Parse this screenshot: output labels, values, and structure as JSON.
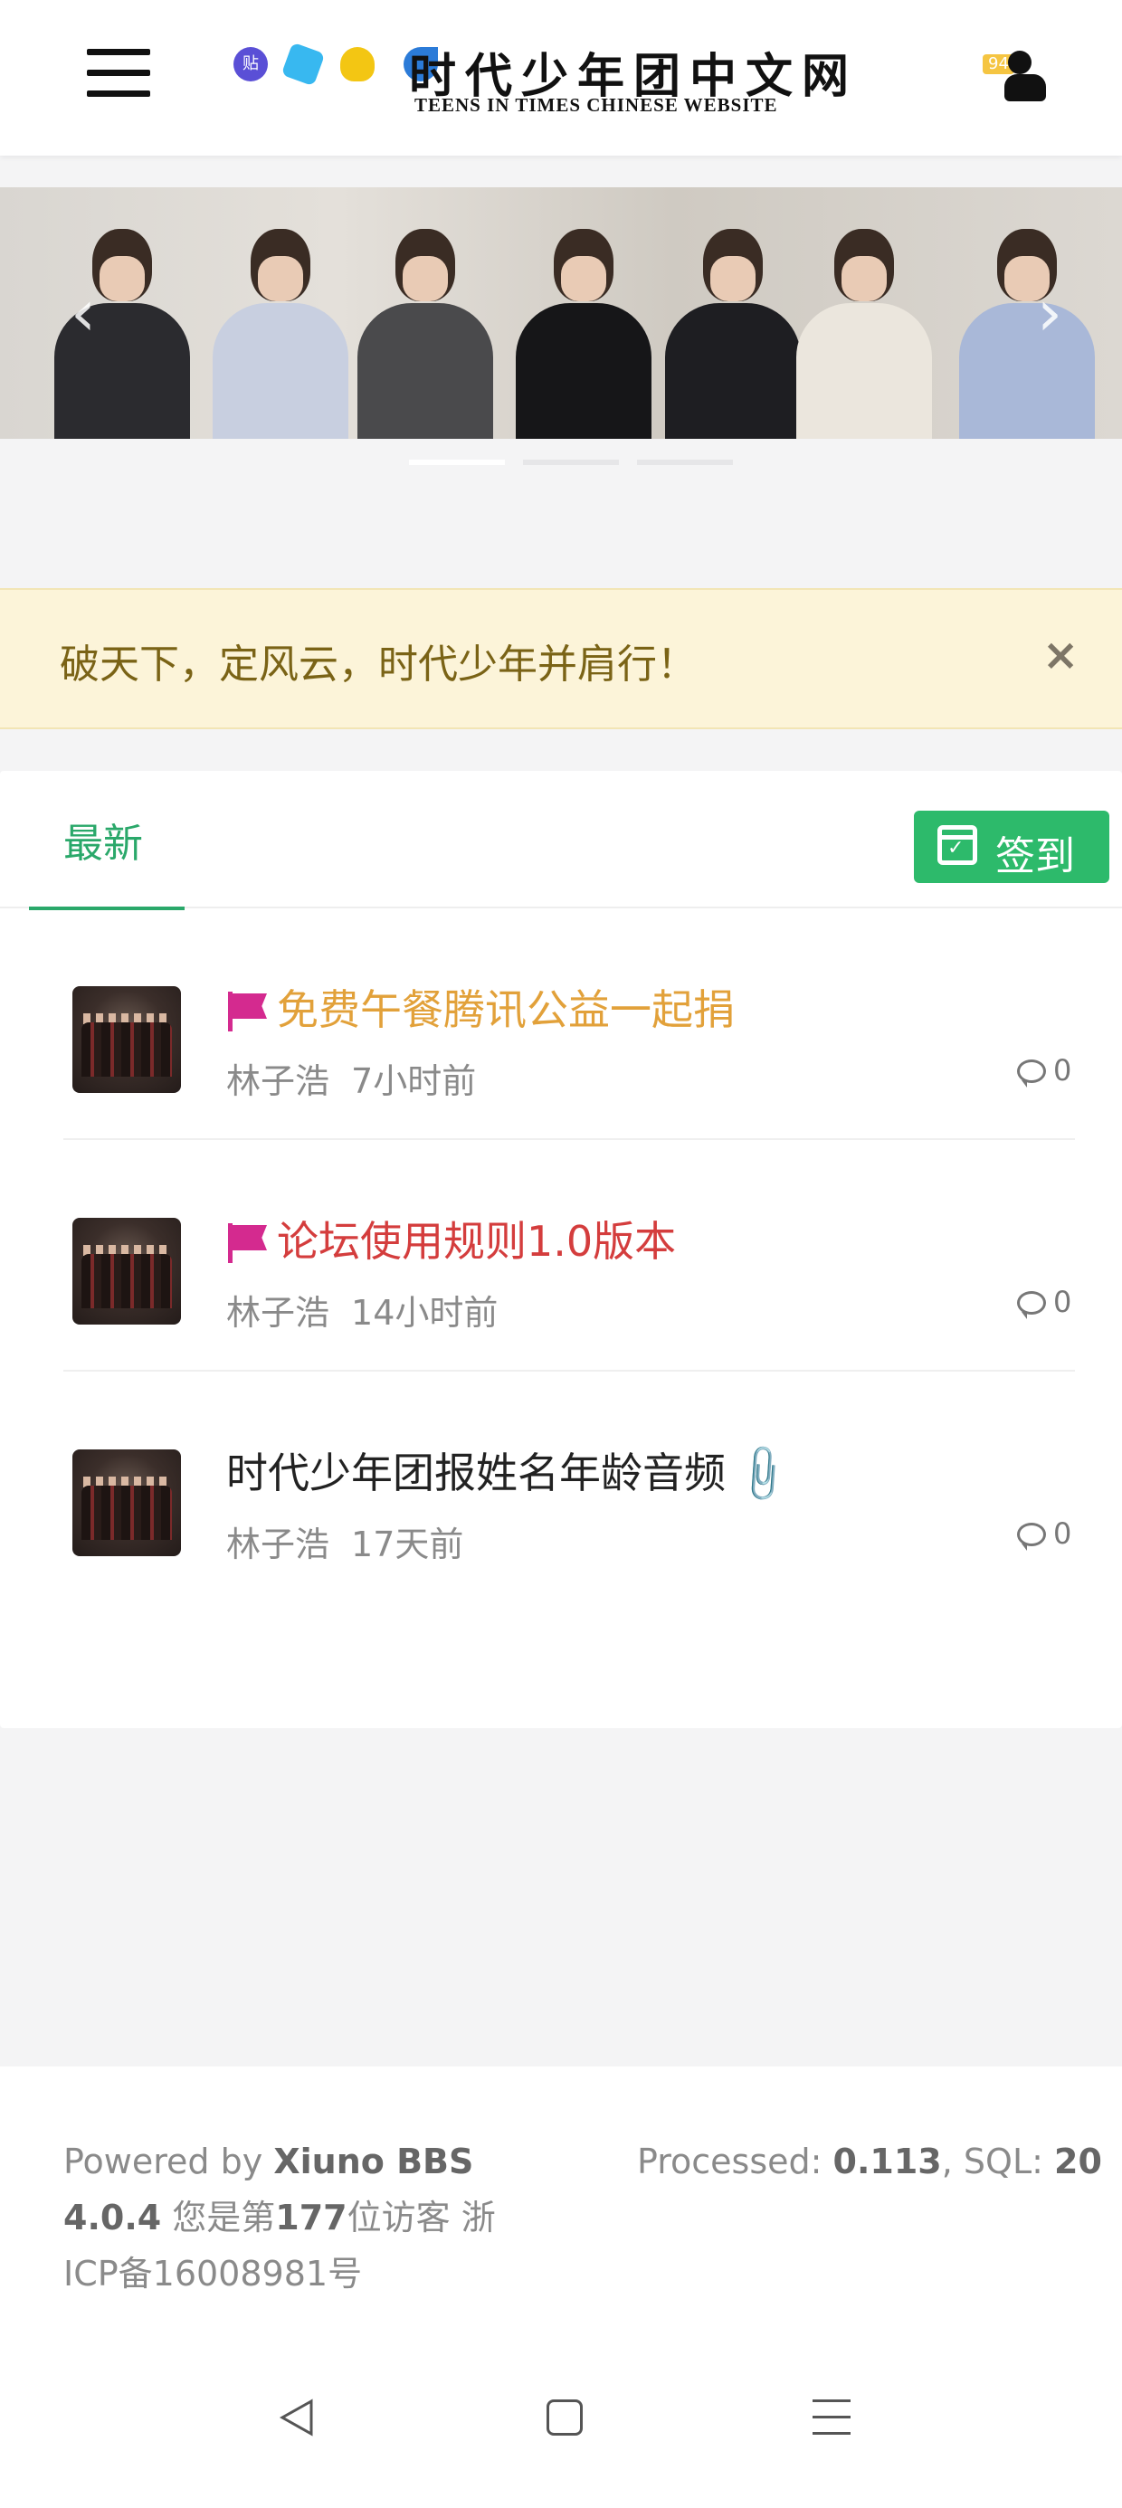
{
  "header": {
    "logo_cn": "时代少年团中文网",
    "logo_en": "TEENS IN TIMES CHINESE WEBSITE",
    "logo_badge": "贴",
    "notification_count": "94"
  },
  "carousel": {
    "slide_count": 3,
    "active_index": 0
  },
  "alert": {
    "message": "破天下，定风云，时代少年并肩行！",
    "close_glyph": "×"
  },
  "tabs": {
    "latest_label": "最新",
    "checkin_label": "签到"
  },
  "threads": [
    {
      "title": "免费午餐腾讯公益一起捐",
      "title_color": "#e2a13a",
      "pinned": true,
      "author": "林子浩",
      "time": "7小时前",
      "replies": "0"
    },
    {
      "title": "论坛使用规则1.0版本",
      "title_color": "#d43d3d",
      "pinned": true,
      "author": "林子浩",
      "time": "14小时前",
      "replies": "0"
    },
    {
      "title": "时代少年团报姓名年龄音频",
      "title_color": "#222222",
      "pinned": false,
      "attachment": true,
      "author": "林子浩",
      "time": "17天前",
      "replies": "0"
    }
  ],
  "footer": {
    "powered_prefix": "Powered by ",
    "powered_name": "Xiuno BBS",
    "version": "4.0.4",
    "visitor_prefix": " 您是第",
    "visitor_count": "177",
    "visitor_suffix": "位访客 浙ICP备16008981号",
    "processed_label": "Processed: ",
    "processed_value": "0.113",
    "sql_label": ", SQL: ",
    "sql_value": "20"
  },
  "colors": {
    "accent_green": "#2aa86a",
    "checkin_green": "#2dba6b",
    "alert_bg": "#fcf4d9",
    "flag_pink": "#d42a8f"
  }
}
